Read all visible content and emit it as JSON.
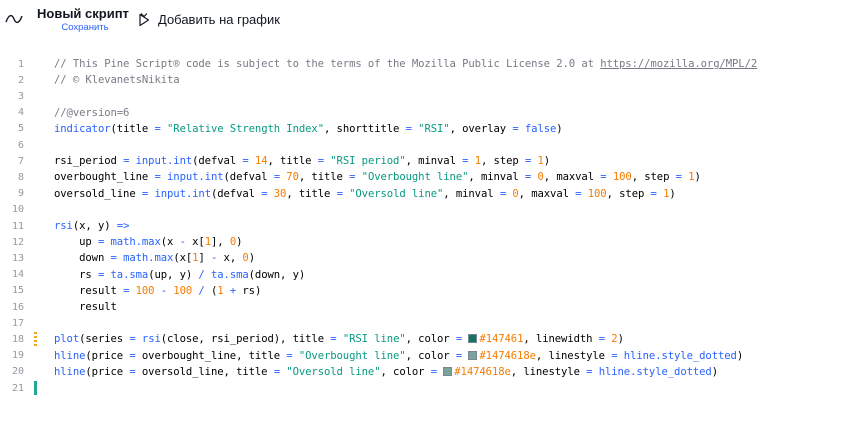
{
  "toolbar": {
    "script_name": "Новый скрипт",
    "save_label": "Сохранить",
    "add_to_chart_label": "Добавить на график"
  },
  "colors": {
    "accent": "#2962ff",
    "string": "#089981",
    "number": "#f57c00",
    "comment": "#787b86",
    "swatch_1": "#147461",
    "swatch_2": "#1474618e"
  },
  "editor": {
    "lines": [
      {
        "n": "1",
        "t": [
          [
            "cm",
            "// This Pine Script® code is subject to the terms of the Mozilla Public License 2.0 at "
          ],
          [
            "cm-u",
            "https://mozilla.org/MPL/2"
          ]
        ]
      },
      {
        "n": "2",
        "t": [
          [
            "cm",
            "// © KlevanetsNikita"
          ]
        ]
      },
      {
        "n": "3",
        "t": []
      },
      {
        "n": "4",
        "t": [
          [
            "cm",
            "//@version=6"
          ]
        ]
      },
      {
        "n": "5",
        "t": [
          [
            "fn",
            "indicator"
          ],
          [
            "var",
            "(title "
          ],
          [
            "op",
            "="
          ],
          [
            "str",
            " \"Relative Strength Index\""
          ],
          [
            "var",
            ", shorttitle "
          ],
          [
            "op",
            "="
          ],
          [
            "str",
            " \"RSI\""
          ],
          [
            "var",
            ", overlay "
          ],
          [
            "op",
            "="
          ],
          [
            "fn",
            " false"
          ],
          [
            "var",
            ")"
          ]
        ]
      },
      {
        "n": "6",
        "t": []
      },
      {
        "n": "7",
        "t": [
          [
            "var",
            "rsi_period "
          ],
          [
            "op",
            "="
          ],
          [
            "fn",
            " input.int"
          ],
          [
            "var",
            "(defval "
          ],
          [
            "op",
            "="
          ],
          [
            "num",
            " 14"
          ],
          [
            "var",
            ", title "
          ],
          [
            "op",
            "="
          ],
          [
            "str",
            " \"RSI period\""
          ],
          [
            "var",
            ", minval "
          ],
          [
            "op",
            "="
          ],
          [
            "num",
            " 1"
          ],
          [
            "var",
            ", step "
          ],
          [
            "op",
            "="
          ],
          [
            "num",
            " 1"
          ],
          [
            "var",
            ")"
          ]
        ]
      },
      {
        "n": "8",
        "t": [
          [
            "var",
            "overbought_line "
          ],
          [
            "op",
            "="
          ],
          [
            "fn",
            " input.int"
          ],
          [
            "var",
            "(defval "
          ],
          [
            "op",
            "="
          ],
          [
            "num",
            " 70"
          ],
          [
            "var",
            ", title "
          ],
          [
            "op",
            "="
          ],
          [
            "str",
            " \"Overbought line\""
          ],
          [
            "var",
            ", minval "
          ],
          [
            "op",
            "="
          ],
          [
            "num",
            " 0"
          ],
          [
            "var",
            ", maxval "
          ],
          [
            "op",
            "="
          ],
          [
            "num",
            " 100"
          ],
          [
            "var",
            ", step "
          ],
          [
            "op",
            "="
          ],
          [
            "num",
            " 1"
          ],
          [
            "var",
            ")"
          ]
        ]
      },
      {
        "n": "9",
        "t": [
          [
            "var",
            "oversold_line "
          ],
          [
            "op",
            "="
          ],
          [
            "fn",
            " input.int"
          ],
          [
            "var",
            "(defval "
          ],
          [
            "op",
            "="
          ],
          [
            "num",
            " 30"
          ],
          [
            "var",
            ", title "
          ],
          [
            "op",
            "="
          ],
          [
            "str",
            " \"Oversold line\""
          ],
          [
            "var",
            ", minval "
          ],
          [
            "op",
            "="
          ],
          [
            "num",
            " 0"
          ],
          [
            "var",
            ", maxval "
          ],
          [
            "op",
            "="
          ],
          [
            "num",
            " 100"
          ],
          [
            "var",
            ", step "
          ],
          [
            "op",
            "="
          ],
          [
            "num",
            " 1"
          ],
          [
            "var",
            ")"
          ]
        ]
      },
      {
        "n": "10",
        "t": []
      },
      {
        "n": "11",
        "t": [
          [
            "fn",
            "rsi"
          ],
          [
            "var",
            "(x, y) "
          ],
          [
            "op",
            "=>"
          ]
        ]
      },
      {
        "n": "12",
        "t": [
          [
            "var",
            "    up "
          ],
          [
            "op",
            "="
          ],
          [
            "fn",
            " math.max"
          ],
          [
            "var",
            "(x "
          ],
          [
            "op",
            "-"
          ],
          [
            "var",
            " x["
          ],
          [
            "num",
            "1"
          ],
          [
            "var",
            "], "
          ],
          [
            "num",
            "0"
          ],
          [
            "var",
            ")"
          ]
        ]
      },
      {
        "n": "13",
        "t": [
          [
            "var",
            "    down "
          ],
          [
            "op",
            "="
          ],
          [
            "fn",
            " math.max"
          ],
          [
            "var",
            "(x["
          ],
          [
            "num",
            "1"
          ],
          [
            "var",
            "] "
          ],
          [
            "op",
            "-"
          ],
          [
            "var",
            " x, "
          ],
          [
            "num",
            "0"
          ],
          [
            "var",
            ")"
          ]
        ]
      },
      {
        "n": "14",
        "t": [
          [
            "var",
            "    rs "
          ],
          [
            "op",
            "="
          ],
          [
            "fn",
            " ta.sma"
          ],
          [
            "var",
            "(up, y) "
          ],
          [
            "op",
            "/"
          ],
          [
            "fn",
            " ta.sma"
          ],
          [
            "var",
            "(down, y)"
          ]
        ]
      },
      {
        "n": "15",
        "t": [
          [
            "var",
            "    result "
          ],
          [
            "op",
            "="
          ],
          [
            "num",
            " 100"
          ],
          [
            "op",
            " -"
          ],
          [
            "num",
            " 100"
          ],
          [
            "op",
            " /"
          ],
          [
            "var",
            " ("
          ],
          [
            "num",
            "1"
          ],
          [
            "op",
            " +"
          ],
          [
            "var",
            " rs)"
          ]
        ]
      },
      {
        "n": "16",
        "t": [
          [
            "var",
            "    result"
          ]
        ]
      },
      {
        "n": "17",
        "t": []
      },
      {
        "n": "18",
        "mark": "yellow",
        "t": [
          [
            "fn",
            "plot"
          ],
          [
            "var",
            "(series "
          ],
          [
            "op",
            "="
          ],
          [
            "fn",
            " rsi"
          ],
          [
            "var",
            "(close, rsi_period), title "
          ],
          [
            "op",
            "="
          ],
          [
            "str",
            " \"RSI line\""
          ],
          [
            "var",
            ", color "
          ],
          [
            "op",
            "="
          ],
          [
            "sw1",
            " "
          ],
          [
            "num",
            "#147461"
          ],
          [
            "var",
            ", linewidth "
          ],
          [
            "op",
            "="
          ],
          [
            "num",
            " 2"
          ],
          [
            "var",
            ")"
          ]
        ]
      },
      {
        "n": "19",
        "t": [
          [
            "fn",
            "hline"
          ],
          [
            "var",
            "(price "
          ],
          [
            "op",
            "="
          ],
          [
            "var",
            " overbought_line, title "
          ],
          [
            "op",
            "="
          ],
          [
            "str",
            " \"Overbought line\""
          ],
          [
            "var",
            ", color "
          ],
          [
            "op",
            "="
          ],
          [
            "sw2",
            " "
          ],
          [
            "num",
            "#1474618e"
          ],
          [
            "var",
            ", linestyle "
          ],
          [
            "op",
            "="
          ],
          [
            "fn",
            " hline.style_dotted"
          ],
          [
            "var",
            ")"
          ]
        ]
      },
      {
        "n": "20",
        "t": [
          [
            "fn",
            "hline"
          ],
          [
            "var",
            "(price "
          ],
          [
            "op",
            "="
          ],
          [
            "var",
            " oversold_line, title "
          ],
          [
            "op",
            "="
          ],
          [
            "str",
            " \"Oversold line\""
          ],
          [
            "var",
            ", color "
          ],
          [
            "op",
            "="
          ],
          [
            "sw2",
            " "
          ],
          [
            "num",
            "#1474618e"
          ],
          [
            "var",
            ", linestyle "
          ],
          [
            "op",
            "="
          ],
          [
            "fn",
            " hline.style_dotted"
          ],
          [
            "var",
            ")"
          ]
        ]
      },
      {
        "n": "21",
        "mark": "green",
        "t": []
      }
    ]
  }
}
